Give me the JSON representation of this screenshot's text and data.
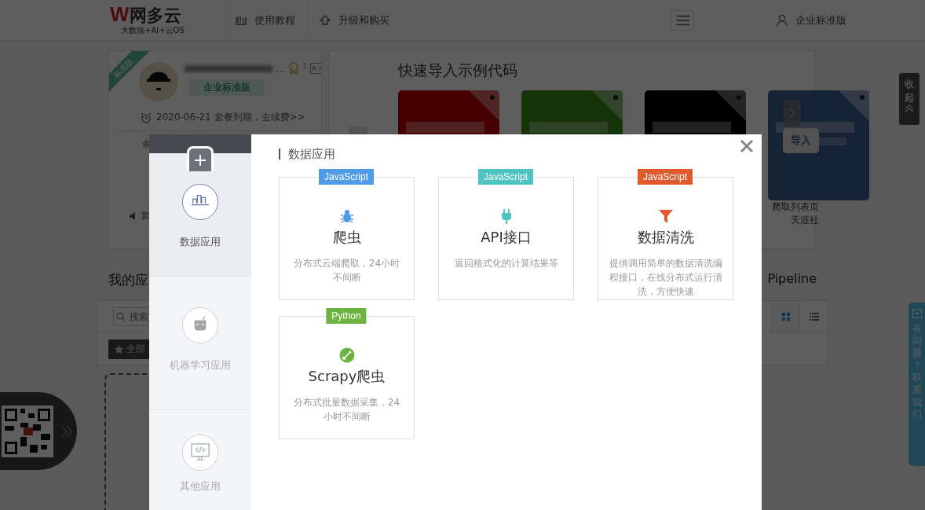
{
  "header": {
    "logo": {
      "mark": "W",
      "name": "网多云",
      "tagline": "大数据+AI+云OS"
    },
    "nav": [
      {
        "kind": "book",
        "label": "使用教程"
      },
      {
        "kind": "upgrade",
        "label": "升级和购买"
      }
    ],
    "user_label": "企业标准版"
  },
  "profile": {
    "ribbon": "标准版",
    "name_suffix": "...",
    "medal_count": "1",
    "badge": "企业标准版",
    "expiry": "2020-06-21 套餐到期，去续费>>",
    "row_fragment": "余",
    "notice_fragment": "套"
  },
  "examples": {
    "title": "快速导入示例代码",
    "cards": [
      {
        "kind": "picture"
      },
      {
        "kind": "picture"
      },
      {
        "kind": "picture"
      },
      {
        "kind": "picture"
      }
    ],
    "import_button": "导入",
    "caption": [
      "爬取列表页",
      "天涯社"
    ]
  },
  "apps_title": "我的应",
  "pipeline_title": "Pipeline",
  "search": {
    "placeholder": "搜索"
  },
  "filter": "全部",
  "view_buttons": [
    {
      "kind": "grid",
      "selected": true
    },
    {
      "kind": "list",
      "selected": false
    }
  ],
  "collapse": "收起",
  "help": "有问题？联系我们",
  "modal": {
    "sidebar": [
      {
        "kind": "chart",
        "label": "数据应用",
        "selected": true
      },
      {
        "kind": "robot",
        "label": "机器学习应用",
        "selected": false
      },
      {
        "kind": "code",
        "label": "其他应用",
        "selected": false
      }
    ],
    "section_title": "数据应用",
    "apps": [
      {
        "tag": "JavaScript",
        "color": "#4f9be8",
        "kind": "bug",
        "title": "爬虫",
        "description": "分布式云端爬取，24小时不间断"
      },
      {
        "tag": "JavaScript",
        "color": "#4fc3c0",
        "kind": "plug",
        "title": "API接口",
        "description": "返回格式化的计算结果等"
      },
      {
        "tag": "JavaScript",
        "color": "#e05a2b",
        "kind": "funnel",
        "title": "数据清洗",
        "description": "提供调用简单的数据清洗编程接口，在线分布式运行清洗，方便快速"
      },
      {
        "tag": "Python",
        "color": "#6db33f",
        "kind": "shovel",
        "title": "Scrapy爬虫",
        "description": "分布式批量数据采集，24小时不间断"
      }
    ]
  }
}
